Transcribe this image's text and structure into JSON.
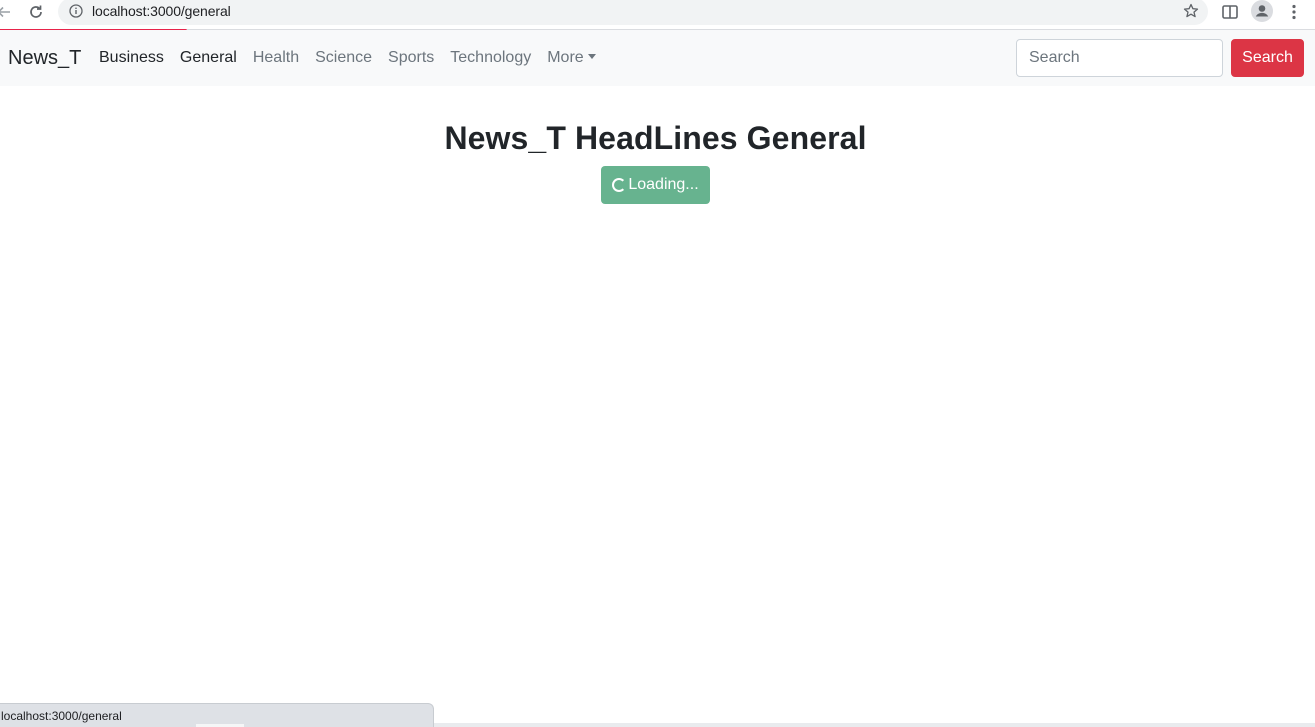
{
  "browser": {
    "url": "localhost:3000/general",
    "status_url": "localhost:3000/general"
  },
  "navbar": {
    "brand": "News_T",
    "links": [
      {
        "label": "Business"
      },
      {
        "label": "General"
      },
      {
        "label": "Health"
      },
      {
        "label": "Science"
      },
      {
        "label": "Sports"
      },
      {
        "label": "Technology"
      },
      {
        "label": "More"
      }
    ],
    "search_placeholder": "Search",
    "search_button": "Search"
  },
  "main": {
    "title": "News_T HeadLines General",
    "loading_label": "Loading..."
  },
  "colors": {
    "accent_danger": "#dc3545",
    "loading_green": "#67b38f",
    "progress_line": "#e8234a"
  },
  "icons": [
    "back-arrow-icon",
    "reload-icon",
    "info-icon",
    "star-icon",
    "side-panel-icon",
    "profile-icon",
    "kebab-menu-icon",
    "spinner-icon"
  ]
}
